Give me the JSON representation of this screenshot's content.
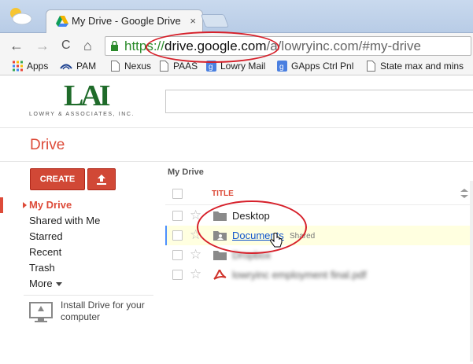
{
  "browser": {
    "tab_title": "My Drive - Google Drive",
    "tab_close": "×",
    "url": {
      "scheme": "https://",
      "host": "drive.google.com",
      "path": "/a/lowryinc.com/#my-drive"
    },
    "nav": {
      "back": "←",
      "forward": "→",
      "reload": "C",
      "home": "⌂"
    },
    "bookmarks": [
      {
        "label": "Apps",
        "icon": "apps-grid-icon"
      },
      {
        "label": "PAM",
        "icon": "pam-icon"
      },
      {
        "label": "Nexus",
        "icon": "page-icon"
      },
      {
        "label": "PAAS",
        "icon": "page-icon"
      },
      {
        "label": "Lowry Mail",
        "icon": "google-icon"
      },
      {
        "label": "GApps Ctrl Pnl",
        "icon": "google-icon"
      },
      {
        "label": "State max and mins",
        "icon": "page-icon"
      }
    ]
  },
  "brand": {
    "logo_text": "LAI",
    "tagline": "LOWRY & ASSOCIATES, INC."
  },
  "drive": {
    "title": "Drive",
    "create_label": "CREATE",
    "upload_icon": "upload-icon",
    "nav": {
      "items": [
        {
          "label": "My Drive"
        },
        {
          "label": "Shared with Me"
        },
        {
          "label": "Starred"
        },
        {
          "label": "Recent"
        },
        {
          "label": "Trash"
        },
        {
          "label": "More"
        }
      ]
    },
    "install": "Install Drive for your computer"
  },
  "list": {
    "breadcrumb": "My Drive",
    "title_header": "TITLE",
    "rows": [
      {
        "name": "Desktop",
        "type": "folder"
      },
      {
        "name": "Documents",
        "type": "shared-folder",
        "tag": "Shared"
      },
      {
        "name": "Dropbox",
        "type": "folder",
        "blurred": true
      },
      {
        "name": "lowryinc employment final.pdf",
        "type": "pdf",
        "blurred": true
      }
    ]
  },
  "colors": {
    "accent": "#dd4b39",
    "link": "#1155cc",
    "callout": "#d6202a",
    "logo": "#1f6b2a"
  }
}
